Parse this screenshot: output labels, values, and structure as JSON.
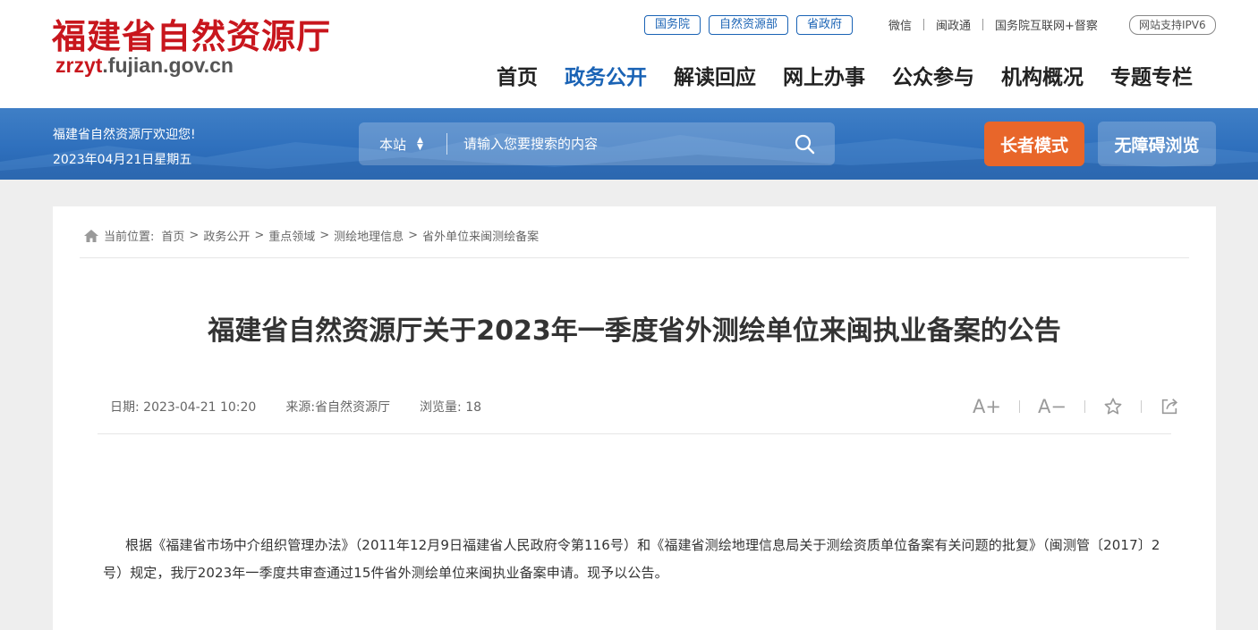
{
  "header": {
    "logo_title": "福建省自然资源厅",
    "logo_url_red": "zrzyt",
    "logo_url_gray": ".fujian.gov.cn",
    "tags": [
      "国务院",
      "自然资源部",
      "省政府"
    ],
    "links": [
      "微信",
      "闽政通",
      "国务院互联网+督察"
    ],
    "ipv6": "网站支持IPV6",
    "nav": [
      "首页",
      "政务公开",
      "解读回应",
      "网上办事",
      "公众参与",
      "机构概况",
      "专题专栏"
    ],
    "active_nav": "政务公开"
  },
  "banner": {
    "welcome": "福建省自然资源厅欢迎您!",
    "date": "2023年04月21日星期五",
    "search_scope": "本站",
    "search_placeholder": "请输入您要搜索的内容",
    "elder_mode": "长者模式",
    "accessible": "无障碍浏览"
  },
  "breadcrumb": {
    "label": "当前位置:",
    "items": [
      "首页",
      "政务公开",
      "重点领域",
      "测绘地理信息",
      "省外单位来闽测绘备案"
    ]
  },
  "article": {
    "title": "福建省自然资源厅关于2023年一季度省外测绘单位来闽执业备案的公告",
    "date": "日期:  2023-04-21 10:20",
    "source": "来源:省自然资源厅",
    "views": "浏览量:  18",
    "font_up": "A+",
    "font_down": "A−",
    "body": "根据《福建省市场中介组织管理办法》（2011年12月9日福建省人民政府令第116号）和《福建省测绘地理信息局关于测绘资质单位备案有关问题的批复》（闽测管〔2017〕2号）规定，我厅2023年一季度共审查通过15件省外测绘单位来闽执业备案申请。现予以公告。"
  },
  "colors": {
    "brand_red": "#c8161d",
    "brand_blue": "#1a63b5",
    "elder_orange": "#e8662a"
  },
  "icons": [
    "home-icon",
    "search-icon",
    "sort-arrows-icon",
    "star-icon",
    "share-icon"
  ]
}
